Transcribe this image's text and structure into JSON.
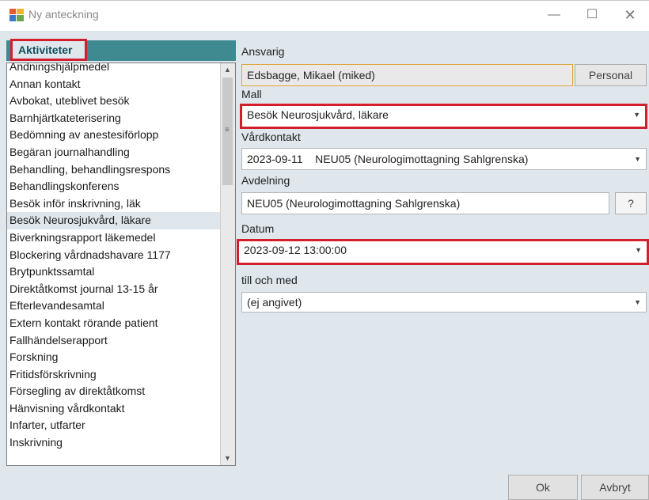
{
  "window": {
    "title": "Ny anteckning",
    "minimize_glyph": "—",
    "maximize_glyph": "☐",
    "close_glyph": "✕"
  },
  "activities": {
    "header": "Aktiviteter",
    "items": [
      "Andningshjälpmedel",
      "Annan kontakt",
      "Avbokat, uteblivet besök",
      "Barnhjärtkateterisering",
      "Bedömning av anestesiförlopp",
      "Begäran journalhandling",
      "Behandling, behandlingsrespons",
      "Behandlingskonferens",
      "Besök inför inskrivning, läk",
      "Besök Neurosjukvård, läkare",
      "Biverkningsrapport läkemedel",
      "Blockering vårdnadshavare 1177",
      "Brytpunktssamtal",
      "Direktåtkomst journal 13-15 år",
      "Efterlevandesamtal",
      "Extern kontakt rörande patient",
      "Fallhändelserapport",
      "Forskning",
      "Fritidsförskrivning",
      "Försegling av direktåtkomst",
      "Hänvisning vårdkontakt",
      "Infarter, utfarter",
      "Inskrivning"
    ],
    "selected_index": 9
  },
  "form": {
    "ansvarig_label": "Ansvarig",
    "ansvarig_value": "Edsbagge, Mikael (miked)",
    "personal_button": "Personal",
    "mall_label": "Mall",
    "mall_value": "Besök Neurosjukvård, läkare",
    "vardkontakt_label": "Vårdkontakt",
    "vardkontakt_value": "2023-09-11    NEU05 (Neurologimottagning Sahlgrenska)",
    "avdelning_label": "Avdelning",
    "avdelning_value": "NEU05 (Neurologimottagning Sahlgrenska)",
    "help_button": "?",
    "datum_label": "Datum",
    "datum_value": "2023-09-12 13:00:00",
    "till_label": "till och med",
    "till_value": "(ej angivet)"
  },
  "buttons": {
    "ok": "Ok",
    "cancel": "Avbryt"
  },
  "colors": {
    "header_teal": "#3f8a90",
    "highlight_red": "#d31f2b",
    "background": "#dfe7ec"
  }
}
